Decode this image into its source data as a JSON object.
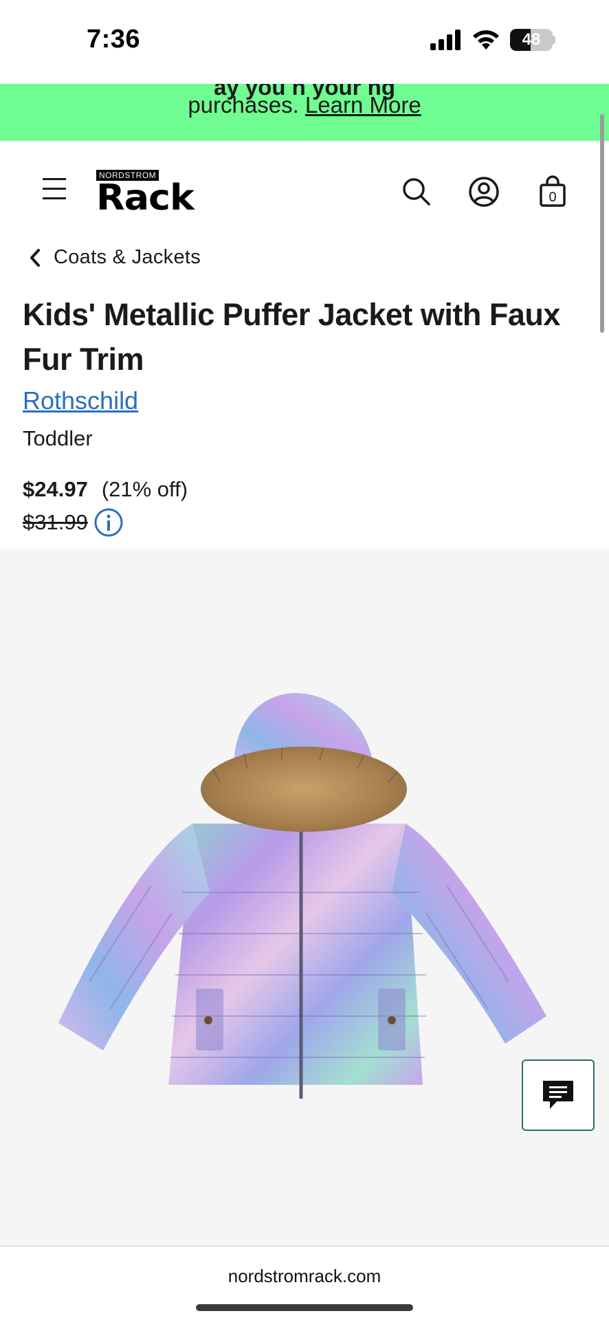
{
  "status": {
    "time": "7:36",
    "battery_level": 48,
    "battery_text": "48",
    "signal_icon": "cellular-signal-icon",
    "wifi_icon": "wifi-icon"
  },
  "promo": {
    "line1": "ay you    n       your     ng",
    "text": "purchases.",
    "link": "Learn More",
    "bg_color": "#6ffd91"
  },
  "header": {
    "logo_small": "NORDSTROM",
    "logo_big": "Rack",
    "menu_icon": "hamburger-menu-icon",
    "search_icon": "search-icon",
    "account_icon": "account-icon",
    "bag_icon": "shopping-bag-icon",
    "bag_count": "0"
  },
  "breadcrumb": {
    "label": "Coats & Jackets"
  },
  "product": {
    "title": "Kids' Metallic Puffer Jacket with Faux Fur Trim",
    "brand": "Rothschild",
    "size_group": "Toddler",
    "price": "$24.97",
    "discount": "(21% off)",
    "original_price": "$31.99",
    "brand_color": "#2a6ebf"
  },
  "chat": {
    "icon": "chat-icon"
  },
  "browser": {
    "url": "nordstromrack.com"
  }
}
